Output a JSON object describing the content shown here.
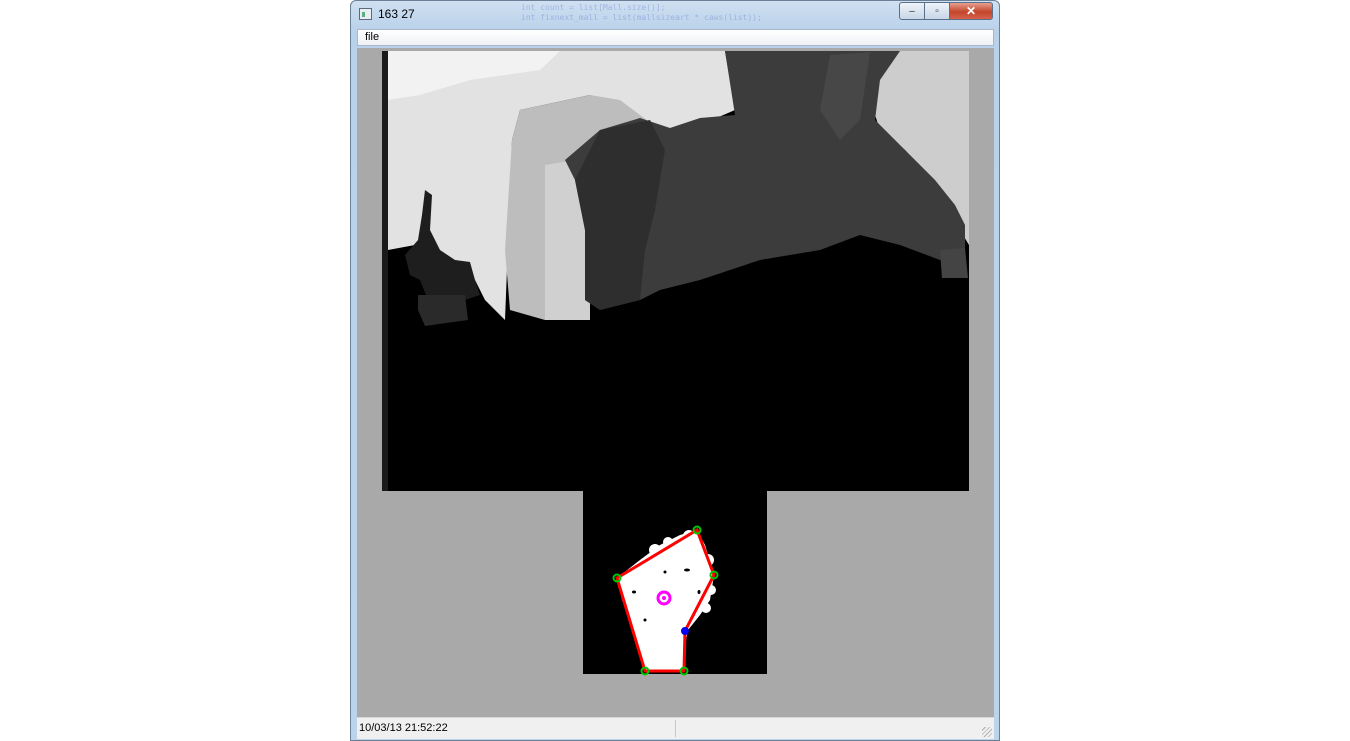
{
  "window": {
    "title": "163 27",
    "behind_text_lines": [
      "int count = list[Mall.size()];",
      "int fixnext_mall = list(mallsizeart * caws(list));"
    ]
  },
  "caption_buttons": {
    "minimize": "‒",
    "maximize": "▫",
    "close": "✕"
  },
  "menu": {
    "items": [
      {
        "label": "file"
      }
    ]
  },
  "status": {
    "timestamp": "10/03/13 21:52:22"
  },
  "colors": {
    "client_background": "#a9a9a9",
    "depth_black": "#000000",
    "hull_outline": "#ff0000",
    "hull_vertex": "#00c800",
    "defect_point": "#0000ff",
    "centroid": "#ff00ff"
  }
}
